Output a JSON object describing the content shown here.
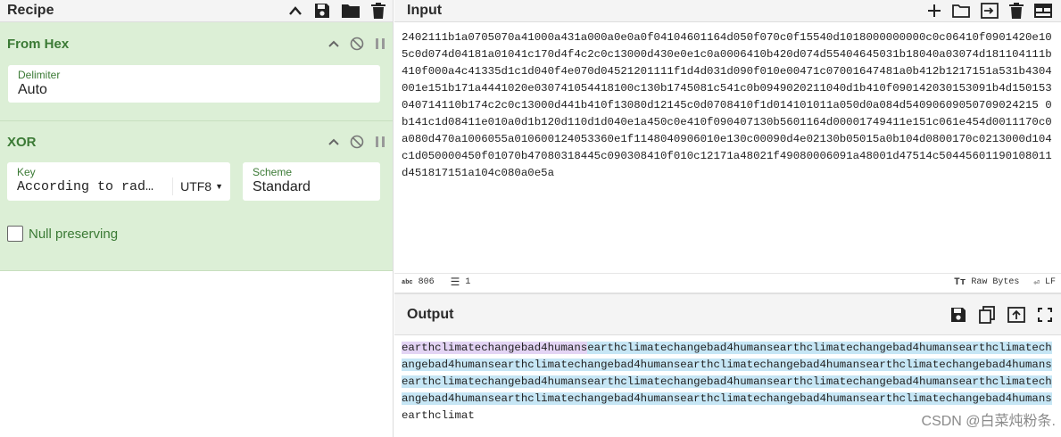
{
  "recipe": {
    "title": "Recipe",
    "header_icons": [
      "chevron-up-icon",
      "save-icon",
      "folder-icon",
      "trash-icon"
    ]
  },
  "from_hex": {
    "title": "From Hex",
    "delimiter_label": "Delimiter",
    "delimiter_value": "Auto"
  },
  "xor": {
    "title": "XOR",
    "key_label": "Key",
    "key_value": "According to rad…",
    "key_encoding": "UTF8",
    "scheme_label": "Scheme",
    "scheme_value": "Standard",
    "null_preserving_label": "Null preserving"
  },
  "input": {
    "title": "Input",
    "text": "2402111b1a0705070a41000a431a000a0e0a0f04104601164d050f070c0f15540d1018000000000c0c06410f0901420e105c0d074d04181a01041c170d4f4c2c0c13000d430e0e1c0a0006410b420d074d55404645031b18040a03074d181104111b410f000a4c41335d1c1d040f4e070d04521201111f1d4d031d090f010e00471c07001647481a0b412b1217151a531b4304001e151b171a4441020e030741054418100c130b1745081c541c0b0949020211040d1b410f090142030153091b4d150153040714110b174c2c0c13000d441b410f13080d12145c0d0708410f1d014101011a050d0a084d54090609050709024215 0b141c1d08411e010a0d1b120d110d1d040e1a450c0e410f090407130b5601164d00001749411e151c061e454d0011170c0a080d470a1006055a010600124053360e1f1148040906010e130c00090d4e02130b05015a0b104d0800170c0213000d104c1d050000450f01070b47080318445c090308410f010c12171a48021f49080006091a48001d47514c50445601190108011d451817151a104c080a0e5a",
    "char_count": "806",
    "line_count": "1",
    "format_label": "Raw Bytes",
    "eol_label": "LF"
  },
  "output": {
    "title": "Output",
    "first_segment": "earthclimatechangebad4humans",
    "highlighted_rest": "earthclimatechangebad4humansearthclimatechangebad4humansearthclimatechangebad4humansearthclimatechangebad4humansearthclimatechangebad4humansearthclimatechangebad4humansearthclimatechangebad4humansearthclimatechangebad4humansearthclimatechangebad4humansearthclimatechangebad4humansearthclimatechangebad4humansearthclimatechangebad4humansearthclimatechangebad4humans",
    "tail": "earthclimat"
  },
  "watermark": "CSDN @白菜炖粉条.",
  "colors": {
    "op_background": "#dcefd6",
    "op_title": "#3b7a35",
    "highlight_first": "#e3d4f4",
    "highlight_rest": "#c6e6f5"
  }
}
